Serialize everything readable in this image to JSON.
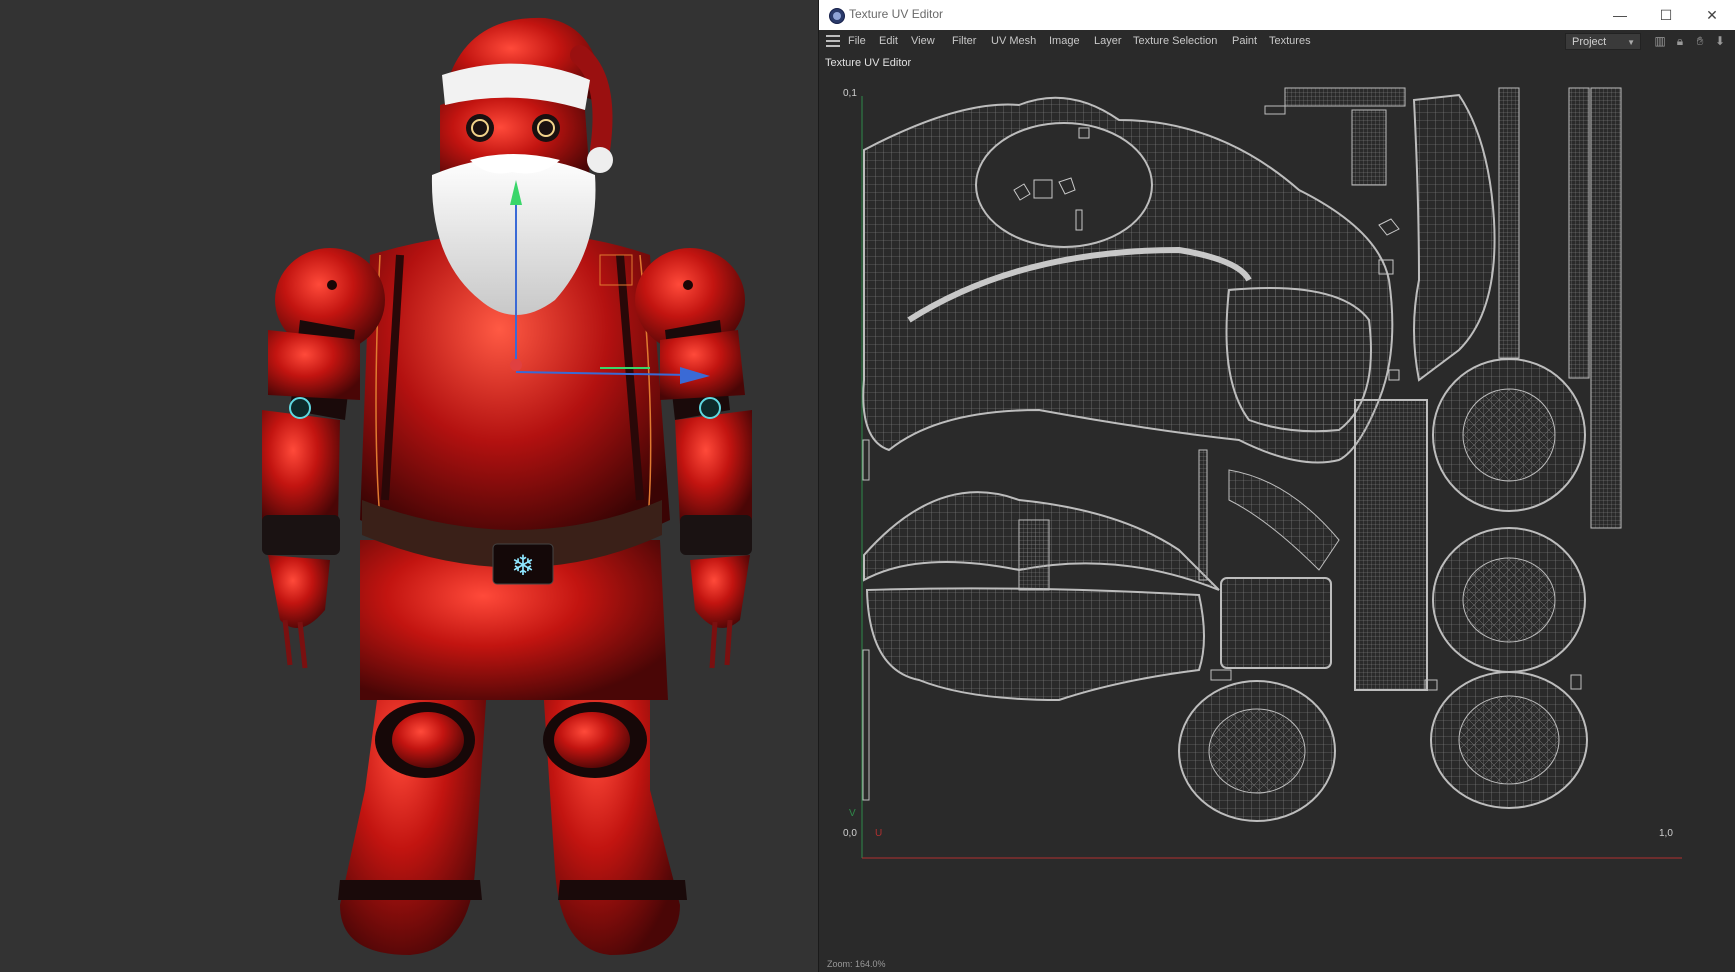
{
  "window": {
    "title": "Texture UV Editor",
    "minimize": "—",
    "maximize": "☐",
    "close": "✕"
  },
  "menu": [
    "File",
    "Edit",
    "View",
    "Filter",
    "UV Mesh",
    "Image",
    "Layer",
    "Texture Selection",
    "Paint",
    "Textures"
  ],
  "toolbar": {
    "project_select": "Project",
    "icons": [
      "histogram-icon",
      "lock-icon",
      "hand-icon",
      "download-icon"
    ]
  },
  "panel_label": "Texture UV Editor",
  "uv_axes": {
    "top_left": "0,1",
    "bottom_left": "0,0",
    "bottom_right": "1,0",
    "v_axis": "V",
    "u_axis": "U"
  },
  "zoom": "Zoom: 164.0%",
  "colors": {
    "background": "#2a2a2a",
    "uv_wire": "#b8b8b8",
    "santa_red": "#c81a12",
    "beard": "#f0f0f0",
    "gizmo_blue": "#3a6ad6",
    "gizmo_green": "#3ad66a",
    "gizmo_red": "#e04040"
  }
}
